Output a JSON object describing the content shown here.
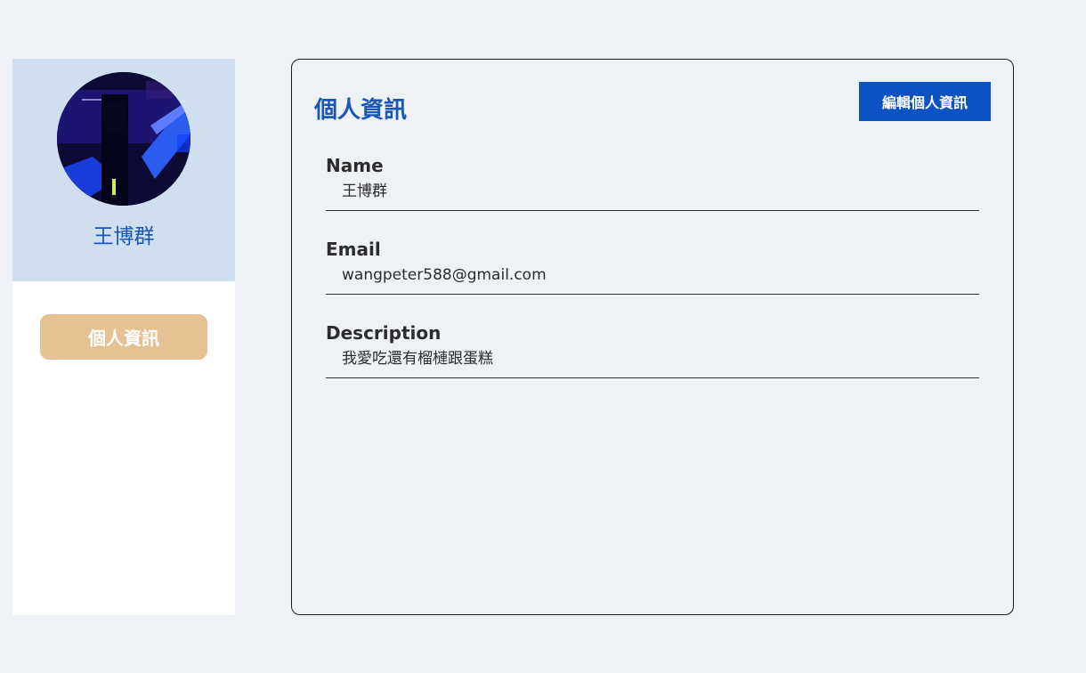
{
  "sidebar": {
    "user_name": "王博群",
    "nav_button_label": "個人資訊"
  },
  "main": {
    "title": "個人資訊",
    "edit_button_label": "編輯個人資訊",
    "fields": [
      {
        "label": "Name",
        "value": "王博群"
      },
      {
        "label": "Email",
        "value": "wangpeter588@gmail.com"
      },
      {
        "label": "Description",
        "value": "我愛吃還有榴槤跟蛋糕"
      }
    ]
  },
  "colors": {
    "page_background": "#eef1f5",
    "sidebar_top_background": "#d0dff0",
    "accent_blue": "#1a56b8",
    "button_blue": "#0d52c2",
    "nav_button_tan": "#e6c194"
  }
}
